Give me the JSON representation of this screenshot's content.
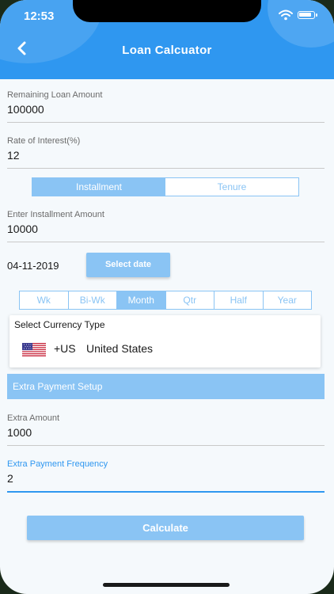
{
  "status_bar": {
    "time": "12:53"
  },
  "header": {
    "title": "Loan Calcuator"
  },
  "fields": {
    "remaining_loan": {
      "label": "Remaining Loan Amount",
      "value": "100000"
    },
    "interest_rate": {
      "label": "Rate of Interest(%)",
      "value": "12"
    },
    "installment_amount": {
      "label": "Enter Installment Amount",
      "value": "10000"
    },
    "extra_amount": {
      "label": "Extra Amount",
      "value": "1000"
    },
    "extra_frequency": {
      "label": "Extra Payment Frequency",
      "value": "2"
    }
  },
  "mode_toggle": {
    "installment": "Installment",
    "tenure": "Tenure",
    "selected": "Installment"
  },
  "date": {
    "value": "04-11-2019",
    "button_label": "Select date"
  },
  "period": {
    "options": [
      "Wk",
      "Bi-Wk",
      "Month",
      "Qtr",
      "Half",
      "Year"
    ],
    "selected": "Month"
  },
  "currency": {
    "title": "Select Currency Type",
    "code": "+US",
    "country": "United States"
  },
  "extra_section": {
    "title": "Extra Payment Setup"
  },
  "calculate_label": "Calculate",
  "colors": {
    "header": "#2f97f0",
    "accent": "#8ac4f4",
    "background": "#f5f9fc"
  },
  "icons": {
    "back": "chevron-left-icon",
    "wifi": "wifi-icon",
    "battery": "battery-icon",
    "flag": "us-flag-icon"
  }
}
